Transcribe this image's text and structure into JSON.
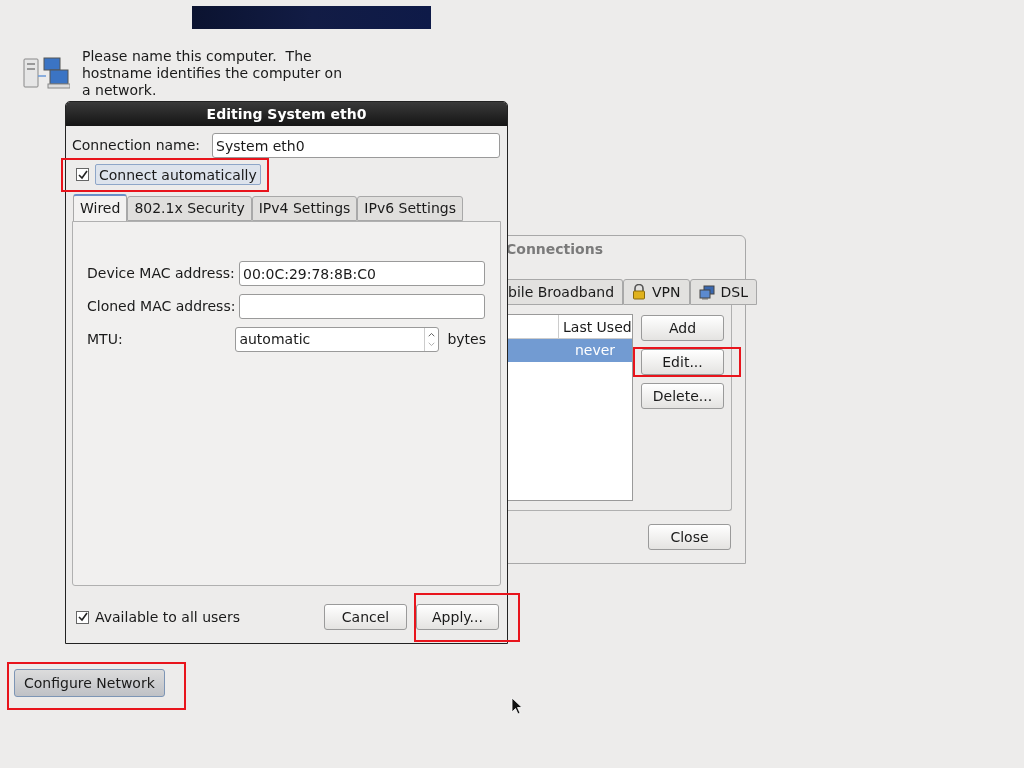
{
  "intro": {
    "text": "Please name this computer.  The hostname identifies the computer on a network."
  },
  "connections_window": {
    "title": "Connections",
    "tabs": [
      {
        "label": "bile Broadband",
        "kind": "plain",
        "selected": false
      },
      {
        "label": "VPN",
        "kind": "lock",
        "selected": false
      },
      {
        "label": "DSL",
        "kind": "monitor",
        "selected": false
      }
    ],
    "table": {
      "columns": [
        "Last Used"
      ],
      "rows": [
        {
          "cells": [
            "never"
          ],
          "selected": true
        }
      ]
    },
    "buttons": [
      {
        "label": "Add",
        "highlighted": false
      },
      {
        "label": "Edit...",
        "highlighted": true
      },
      {
        "label": "Delete...",
        "highlighted": false
      }
    ],
    "close_button": {
      "label": "Close"
    }
  },
  "dialog": {
    "title": "Editing System eth0",
    "connection_name": {
      "label": "Connection name:",
      "value": "System eth0"
    },
    "connect_automatically": {
      "label": "Connect automatically",
      "checked": true,
      "highlighted": true
    },
    "tabs": [
      {
        "label": "Wired",
        "selected": true
      },
      {
        "label": "802.1x Security",
        "selected": false
      },
      {
        "label": "IPv4 Settings",
        "selected": false
      },
      {
        "label": "IPv6 Settings",
        "selected": false
      }
    ],
    "fields": [
      {
        "label": "Device MAC address:",
        "value": "00:0C:29:78:8B:C0",
        "kind": "text"
      },
      {
        "label": "Cloned MAC address:",
        "kind": "text"
      },
      {
        "label": "MTU:",
        "value": "automatic",
        "kind": "spin",
        "unit": "bytes"
      }
    ],
    "available_to_all_users": {
      "label": "Available to all users",
      "checked": true
    },
    "buttons": [
      {
        "label": "Cancel",
        "highlighted": false
      },
      {
        "label": "Apply...",
        "highlighted": true
      }
    ]
  },
  "configure_network": {
    "label": "Configure Network",
    "highlighted": true
  }
}
